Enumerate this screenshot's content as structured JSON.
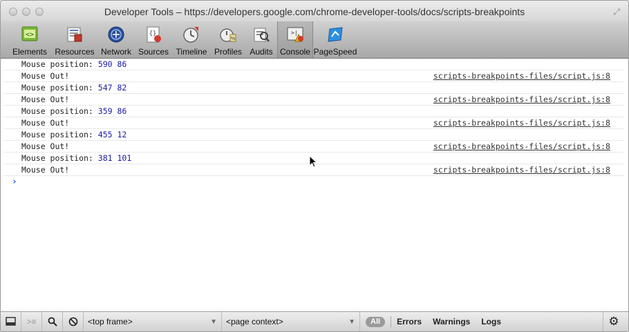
{
  "window": {
    "title": "Developer Tools – https://developers.google.com/chrome-developer-tools/docs/scripts-breakpoints"
  },
  "toolbar": {
    "items": [
      {
        "label": "Elements",
        "icon": "elements-icon"
      },
      {
        "label": "Resources",
        "icon": "resources-icon"
      },
      {
        "label": "Network",
        "icon": "network-icon"
      },
      {
        "label": "Sources",
        "icon": "sources-icon"
      },
      {
        "label": "Timeline",
        "icon": "timeline-icon"
      },
      {
        "label": "Profiles",
        "icon": "profiles-icon"
      },
      {
        "label": "Audits",
        "icon": "audits-icon"
      },
      {
        "label": "Console",
        "icon": "console-icon"
      },
      {
        "label": "PageSpeed",
        "icon": "pagespeed-icon"
      }
    ],
    "active": "Console"
  },
  "console": {
    "rows": [
      {
        "text": "Mouse position: ",
        "num": "590 86",
        "src": ""
      },
      {
        "text": "Mouse Out!",
        "num": "",
        "src": "scripts-breakpoints-files/script.js:8"
      },
      {
        "text": "Mouse position: ",
        "num": "547 82",
        "src": ""
      },
      {
        "text": "Mouse Out!",
        "num": "",
        "src": "scripts-breakpoints-files/script.js:8"
      },
      {
        "text": "Mouse position: ",
        "num": "359 86",
        "src": ""
      },
      {
        "text": "Mouse Out!",
        "num": "",
        "src": "scripts-breakpoints-files/script.js:8"
      },
      {
        "text": "Mouse position: ",
        "num": "455 12",
        "src": ""
      },
      {
        "text": "Mouse Out!",
        "num": "",
        "src": "scripts-breakpoints-files/script.js:8"
      },
      {
        "text": "Mouse position: ",
        "num": "381 101",
        "src": ""
      },
      {
        "text": "Mouse Out!",
        "num": "",
        "src": "scripts-breakpoints-files/script.js:8"
      }
    ],
    "prompt": "›"
  },
  "statusbar": {
    "frame_select": "<top frame>",
    "context_select": "<page context>",
    "filter_all": "All",
    "filter_errors": "Errors",
    "filter_warnings": "Warnings",
    "filter_logs": "Logs"
  },
  "colors": {
    "number": "#1a1aa6",
    "prompt": "#2463d8"
  }
}
